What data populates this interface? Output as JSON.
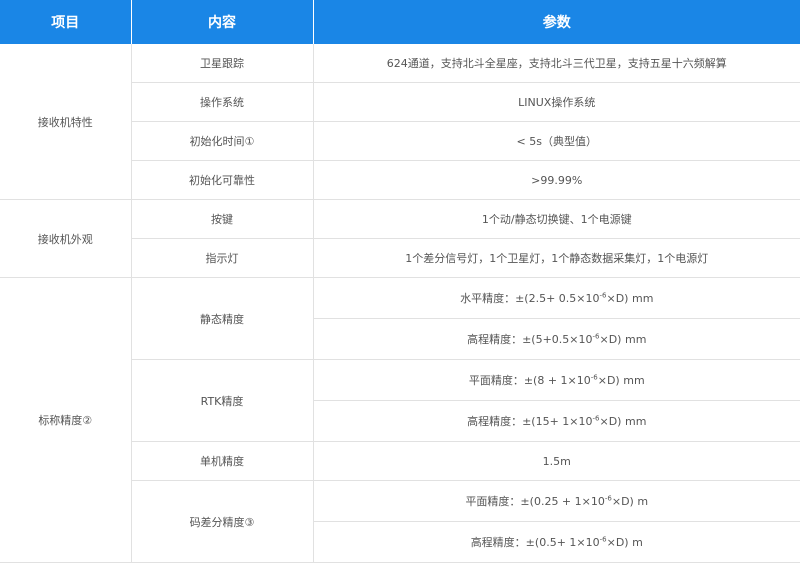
{
  "header": {
    "col1": "项目",
    "col2": "内容",
    "col3": "参数"
  },
  "groups": {
    "receiver_features": "接收机特性",
    "receiver_appearance": "接收机外观",
    "nominal_accuracy": "标称精度②"
  },
  "rows": {
    "satellite_tracking": {
      "label": "卫星跟踪",
      "value": "624通道，支持北斗全星座，支持北斗三代卫星，支持五星十六频解算"
    },
    "os": {
      "label": "操作系统",
      "value": "LINUX操作系统"
    },
    "init_time": {
      "label": "初始化时间①",
      "value": "< 5s（典型值）"
    },
    "init_reliability": {
      "label": "初始化可靠性",
      "value": ">99.99%"
    },
    "keys": {
      "label": "按键",
      "value": "1个动/静态切换键、1个电源键"
    },
    "indicators": {
      "label": "指示灯",
      "value": "1个差分信号灯，1个卫星灯，1个静态数据采集灯，1个电源灯"
    },
    "static": {
      "label": "静态精度",
      "h": {
        "prefix": "水平精度：±(2.5+ 0.5×10",
        "exp": "-6",
        "suffix": "×D) mm"
      },
      "v": {
        "prefix": "高程精度：±(5+0.5×10",
        "exp": "-6",
        "suffix": "×D) mm"
      }
    },
    "rtk": {
      "label": "RTK精度",
      "h": {
        "prefix": "平面精度：±(8 + 1×10",
        "exp": "-6",
        "suffix": "×D) mm"
      },
      "v": {
        "prefix": "高程精度：±(15+ 1×10",
        "exp": "-6",
        "suffix": "×D) mm"
      }
    },
    "single": {
      "label": "单机精度",
      "value": "1.5m"
    },
    "code_diff": {
      "label": "码差分精度③",
      "h": {
        "prefix": "平面精度：±(0.25 + 1×10",
        "exp": "-6",
        "suffix": "×D) m"
      },
      "v": {
        "prefix": "高程精度：±(0.5+ 1×10",
        "exp": "-6",
        "suffix": "×D) m"
      }
    }
  },
  "colors": {
    "header_bg": "#1a86e6",
    "header_text": "#ffffff",
    "border": "#e1e1e1",
    "text": "#555555"
  }
}
